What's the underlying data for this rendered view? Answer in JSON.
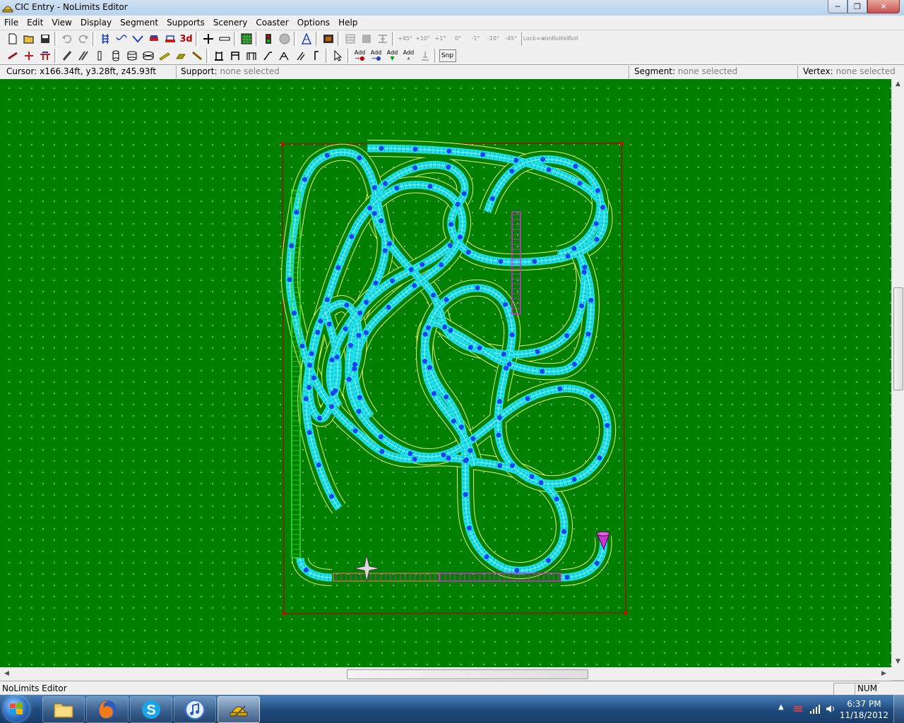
{
  "window": {
    "title": "CIC Entry - NoLimits Editor",
    "minimize_glyph": "─",
    "maximize_glyph": "❐",
    "close_glyph": "✕"
  },
  "menu": [
    "File",
    "Edit",
    "View",
    "Display",
    "Segment",
    "Supports",
    "Scenery",
    "Coaster",
    "Options",
    "Help"
  ],
  "toolbar1": {
    "view_3d_label": "3d",
    "angle_labels": [
      "+45°",
      "+10°",
      "+1°",
      "0°",
      "-1°",
      "-10°",
      "-45°"
    ],
    "lock_label": [
      "Lock",
      "∞∞"
    ],
    "con_roll_label": [
      "con",
      "Roll"
    ],
    "rel_roll_label": [
      "rel",
      "Roll"
    ]
  },
  "toolbar2": {
    "add_labels": [
      "Add",
      "Add",
      "Add",
      "Add"
    ],
    "snap_label": "Snp"
  },
  "status": {
    "cursor_label": "Cursor:",
    "cursor_value": "x166.34ft, y3.28ft, z45.93ft",
    "support_label": "Support:",
    "support_value": "none selected",
    "segment_label": "Segment:",
    "segment_value": "none selected",
    "vertex_label": "Vertex:",
    "vertex_value": "none selected"
  },
  "bottom_status": {
    "text": "NoLimits Editor",
    "num": "NUM"
  },
  "taskbar": {
    "apps": [
      "explorer-folder-icon",
      "firefox-icon",
      "skype-icon",
      "itunes-icon",
      "nolimits-editor-icon"
    ],
    "clock_time": "6:37 PM",
    "clock_date": "11/18/2012"
  },
  "colors": {
    "grass": "#008000",
    "track_rail": "#22e0e8",
    "track_outline": "#ffff66",
    "vertex": "#1844f0",
    "lift_segment": "#cc33cc",
    "station_segment": "#33cc33",
    "boundary": "#b00000"
  }
}
